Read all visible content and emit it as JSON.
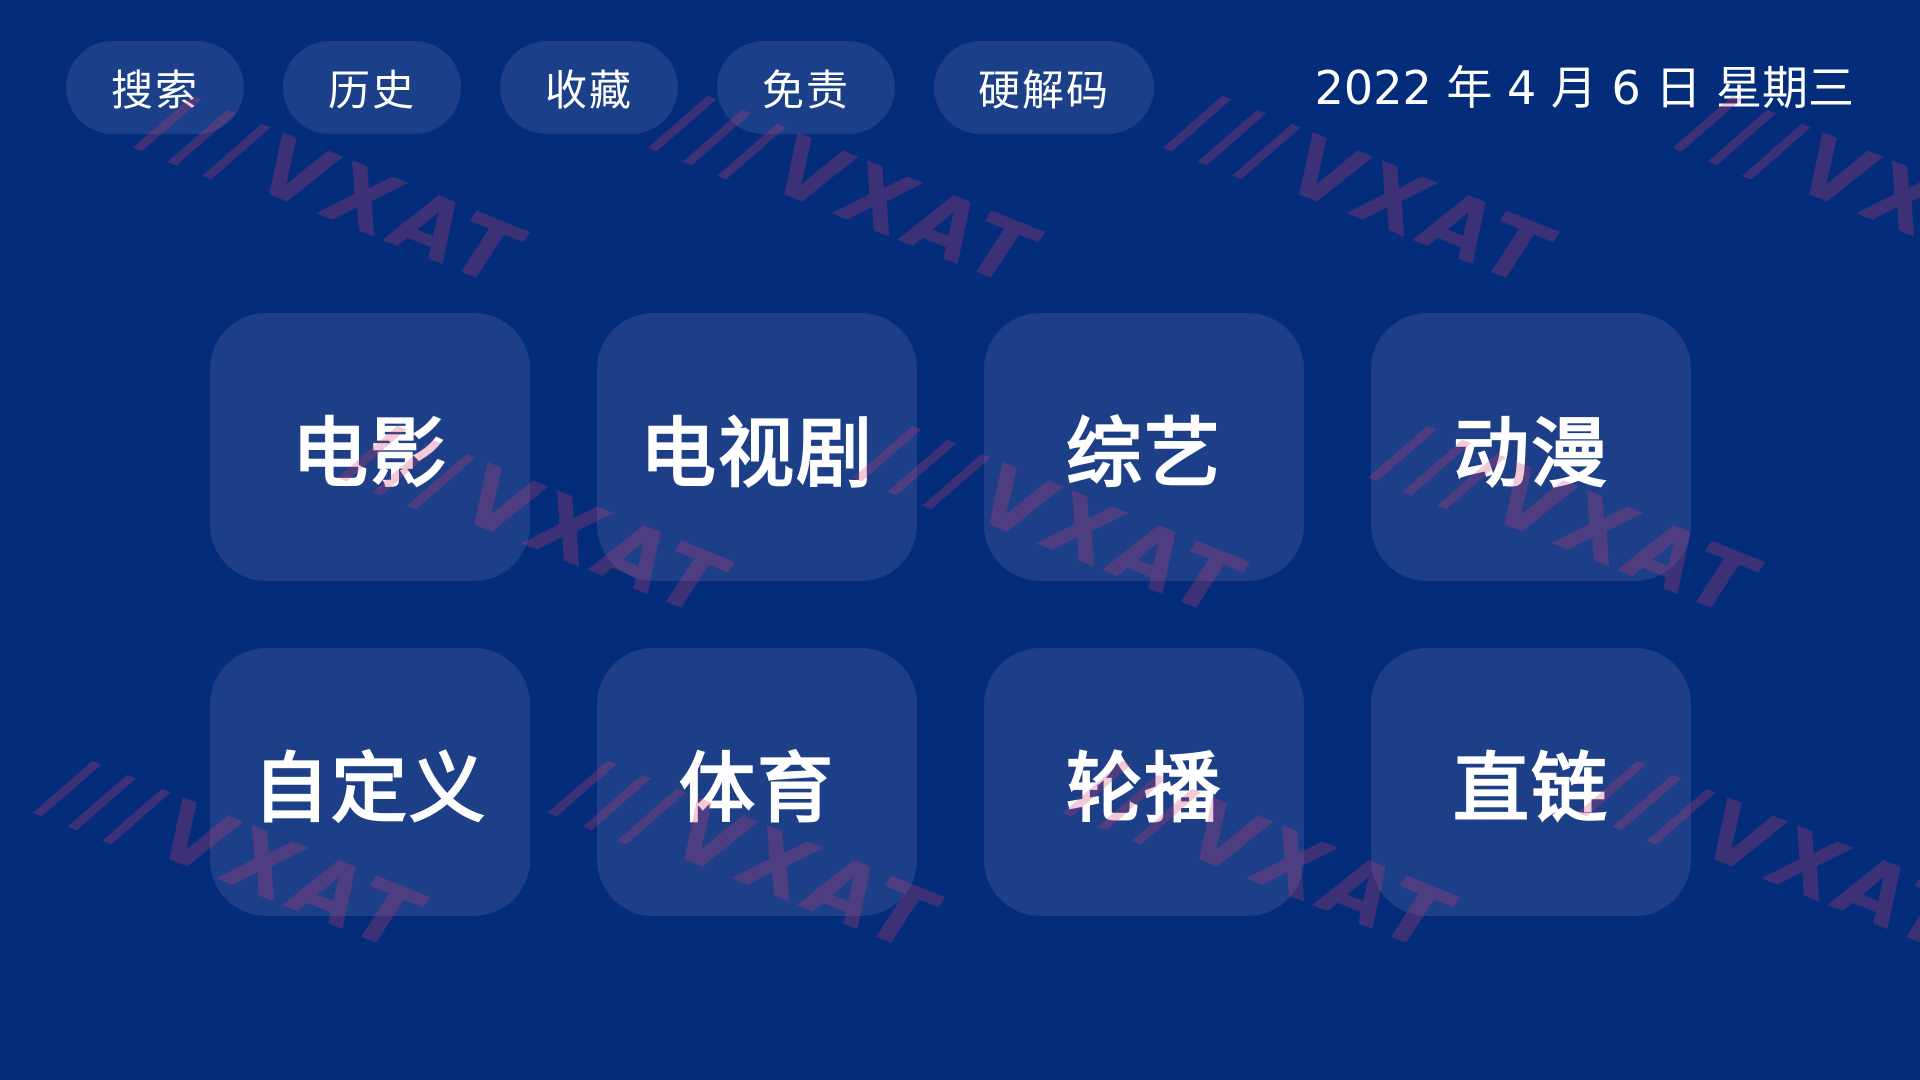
{
  "nav": {
    "items": [
      {
        "label": "搜索"
      },
      {
        "label": "历史"
      },
      {
        "label": "收藏"
      },
      {
        "label": "免责"
      },
      {
        "label": "硬解码"
      }
    ]
  },
  "datetime": "2022 年 4 月 6 日 星期三",
  "categories": [
    {
      "label": "电影"
    },
    {
      "label": "电视剧"
    },
    {
      "label": "综艺"
    },
    {
      "label": "动漫"
    },
    {
      "label": "自定义"
    },
    {
      "label": "体育"
    },
    {
      "label": "轮播"
    },
    {
      "label": "直链"
    }
  ],
  "watermark": "VXAT",
  "colors": {
    "background": "#032c7a",
    "tile": "#1c3f88",
    "pill": "#1b3f88",
    "text": "#ffffff"
  }
}
